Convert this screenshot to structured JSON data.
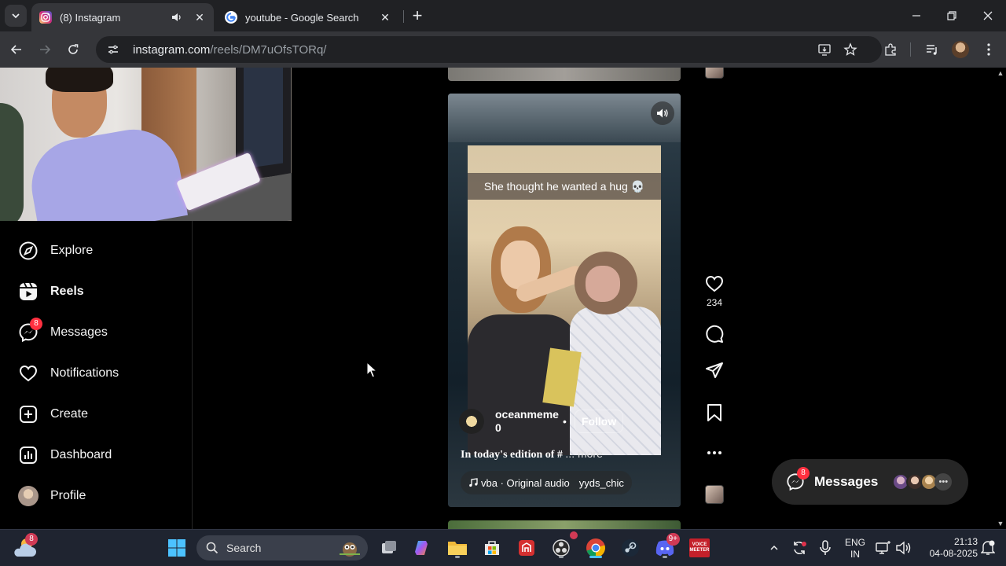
{
  "browser": {
    "tabs": [
      {
        "title": "(8) Instagram",
        "active": true
      },
      {
        "title": "youtube - Google Search",
        "active": false
      }
    ],
    "url_host": "instagram.com",
    "url_path": "/reels/DM7uOfsTORq/"
  },
  "sidebar": {
    "items": [
      {
        "label": "Explore",
        "icon": "compass-icon"
      },
      {
        "label": "Reels",
        "icon": "reels-icon"
      },
      {
        "label": "Messages",
        "icon": "messenger-icon",
        "badge": "8"
      },
      {
        "label": "Notifications",
        "icon": "heart-icon"
      },
      {
        "label": "Create",
        "icon": "plus-square-icon"
      },
      {
        "label": "Dashboard",
        "icon": "dashboard-icon"
      },
      {
        "label": "Profile",
        "icon": "profile-avatar"
      }
    ]
  },
  "reel": {
    "caption_overlay": "She thought he wanted a hug 💀",
    "username": "oceanmeme\n0",
    "follow_label": "Follow",
    "description": "In today's edition of #",
    "more_label": "... more",
    "audio_artist": "vba",
    "audio_title": "Original audio",
    "audio_user": "yyds_chic",
    "like_count": "234"
  },
  "messages_pill": {
    "label": "Messages",
    "badge": "8"
  },
  "taskbar": {
    "weather_badge": "8",
    "search_label": "Search",
    "discord_badge": "9+",
    "voicemeeter_label": "VOICE\nMEETER",
    "lang_top": "ENG",
    "lang_bottom": "IN",
    "time": "21:13",
    "date": "04-08-2025"
  },
  "colors": {
    "instagram_bg": "#000000",
    "badge_red": "#ff3040",
    "chrome_dark": "#202124",
    "chrome_toolbar": "#35363a",
    "taskbar": "#1f2430"
  }
}
